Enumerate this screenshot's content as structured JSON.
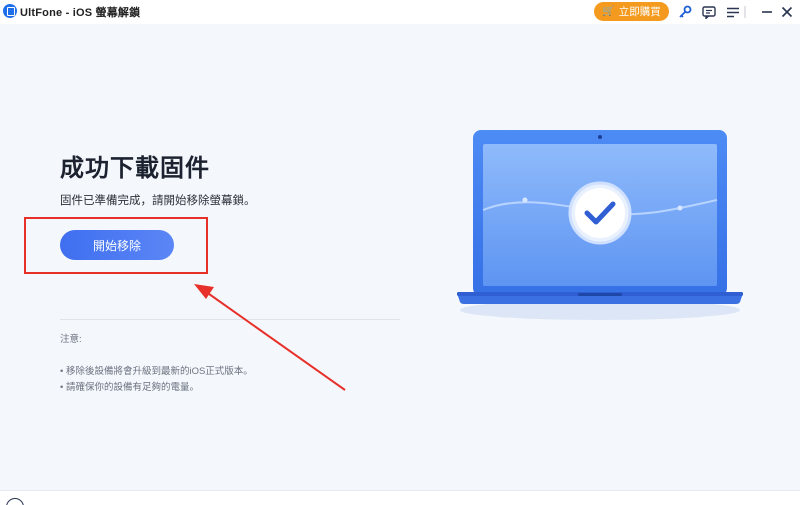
{
  "app": {
    "title": "UltFone - iOS 螢幕解鎖"
  },
  "toolbar": {
    "buy_label": "立即購買",
    "icons": [
      "key-icon",
      "feedback-icon",
      "menu-icon",
      "minimize-icon",
      "close-icon"
    ]
  },
  "main": {
    "heading": "成功下載固件",
    "subtitle": "固件已準備完成，請開始移除螢幕鎖。",
    "start_button": "開始移除",
    "notes_title": "注意:",
    "notes": [
      "• 移除後設備將會升級到最新的iOS正式版本。",
      "• 請確保你的設備有足夠的電量。"
    ]
  },
  "colors": {
    "accent": "#4a79f3",
    "buy": "#f39a1f",
    "highlight": "#e8302a",
    "background": "#f4f7fb"
  }
}
